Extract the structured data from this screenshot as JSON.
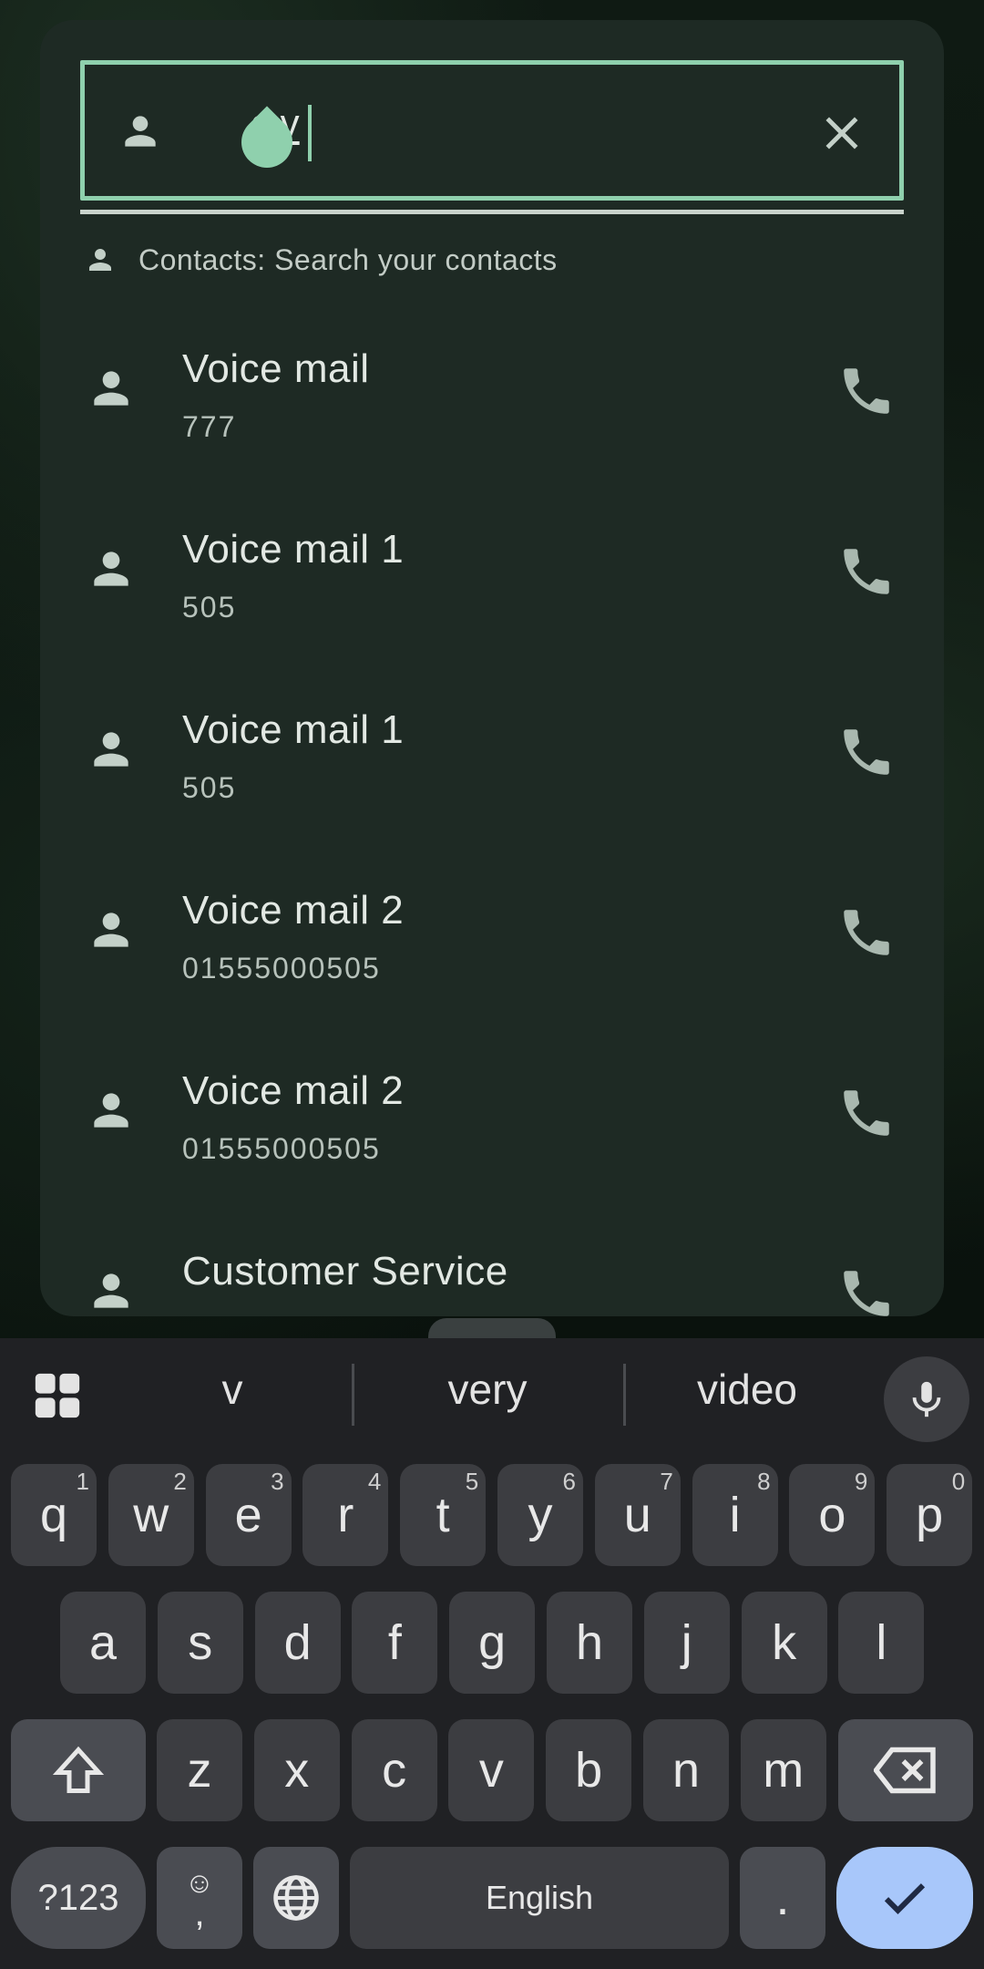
{
  "search": {
    "query_prefix": "c ",
    "query_typed": "v"
  },
  "section_header": "Contacts: Search your contacts",
  "contacts": [
    {
      "name": "Voice mail",
      "number": "777"
    },
    {
      "name": "Voice mail 1",
      "number": "505"
    },
    {
      "name": "Voice mail 1",
      "number": "505"
    },
    {
      "name": "Voice mail 2",
      "number": "01555000505"
    },
    {
      "name": "Voice mail 2",
      "number": "01555000505"
    },
    {
      "name": "Customer Service",
      "number": ""
    }
  ],
  "keyboard": {
    "suggestions": [
      "v",
      "very",
      "video"
    ],
    "row1": [
      [
        "q",
        "1"
      ],
      [
        "w",
        "2"
      ],
      [
        "e",
        "3"
      ],
      [
        "r",
        "4"
      ],
      [
        "t",
        "5"
      ],
      [
        "y",
        "6"
      ],
      [
        "u",
        "7"
      ],
      [
        "i",
        "8"
      ],
      [
        "o",
        "9"
      ],
      [
        "p",
        "0"
      ]
    ],
    "row2": [
      "a",
      "s",
      "d",
      "f",
      "g",
      "h",
      "j",
      "k",
      "l"
    ],
    "row3": [
      "z",
      "x",
      "c",
      "v",
      "b",
      "n",
      "m"
    ],
    "symbols_label": "?123",
    "emoji_comma_top": "☺",
    "emoji_comma_bottom": ",",
    "space_label": "English",
    "period_label": "."
  },
  "colors": {
    "accent": "#8fd0ad",
    "enter_key": "#a8c7fa",
    "sheet": "#1e2a24",
    "keyboard": "#202124"
  }
}
